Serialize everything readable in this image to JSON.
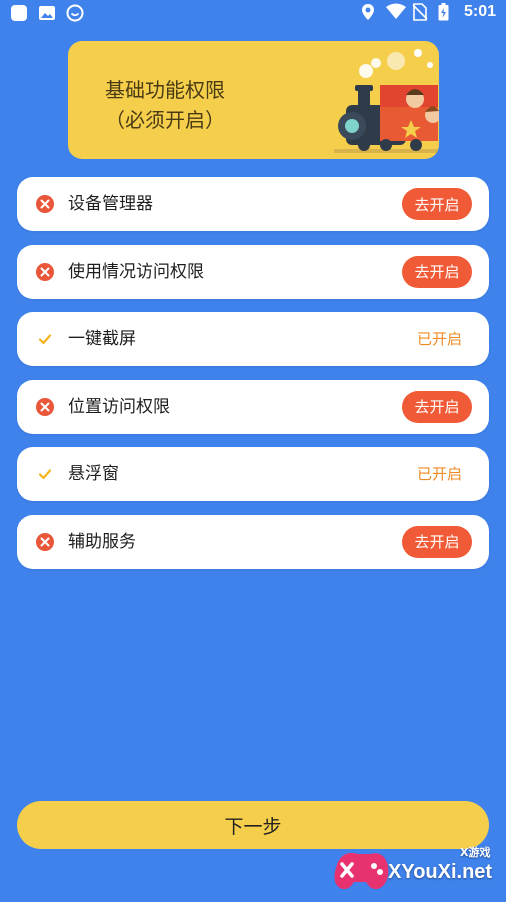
{
  "status_bar": {
    "time": "5:01",
    "left_icons": [
      "app-icon",
      "image-icon",
      "face-icon"
    ],
    "right_icons": [
      "location-icon",
      "wifi-icon",
      "no-sim-icon",
      "battery-icon"
    ]
  },
  "banner": {
    "title_line1": "基础功能权限",
    "title_line2": "（必须开启）",
    "illustration": "train-with-children-icon"
  },
  "permissions": [
    {
      "label": "设备管理器",
      "status": "disabled",
      "action": "去开启"
    },
    {
      "label": "使用情况访问权限",
      "status": "disabled",
      "action": "去开启"
    },
    {
      "label": "一键截屏",
      "status": "enabled",
      "action": "已开启"
    },
    {
      "label": "位置访问权限",
      "status": "disabled",
      "action": "去开启"
    },
    {
      "label": "悬浮窗",
      "status": "enabled",
      "action": "已开启"
    },
    {
      "label": "辅助服务",
      "status": "disabled",
      "action": "去开启"
    }
  ],
  "next_button": "下一步",
  "watermark": {
    "text": "XYouXi.net",
    "sub": "X游戏"
  },
  "colors": {
    "background": "#3f82ec",
    "banner": "#f5cf4b",
    "action_button": "#f15a37",
    "enabled_text": "#f08a24",
    "check": "#f5b41c",
    "error_icon": "#e9563a"
  }
}
